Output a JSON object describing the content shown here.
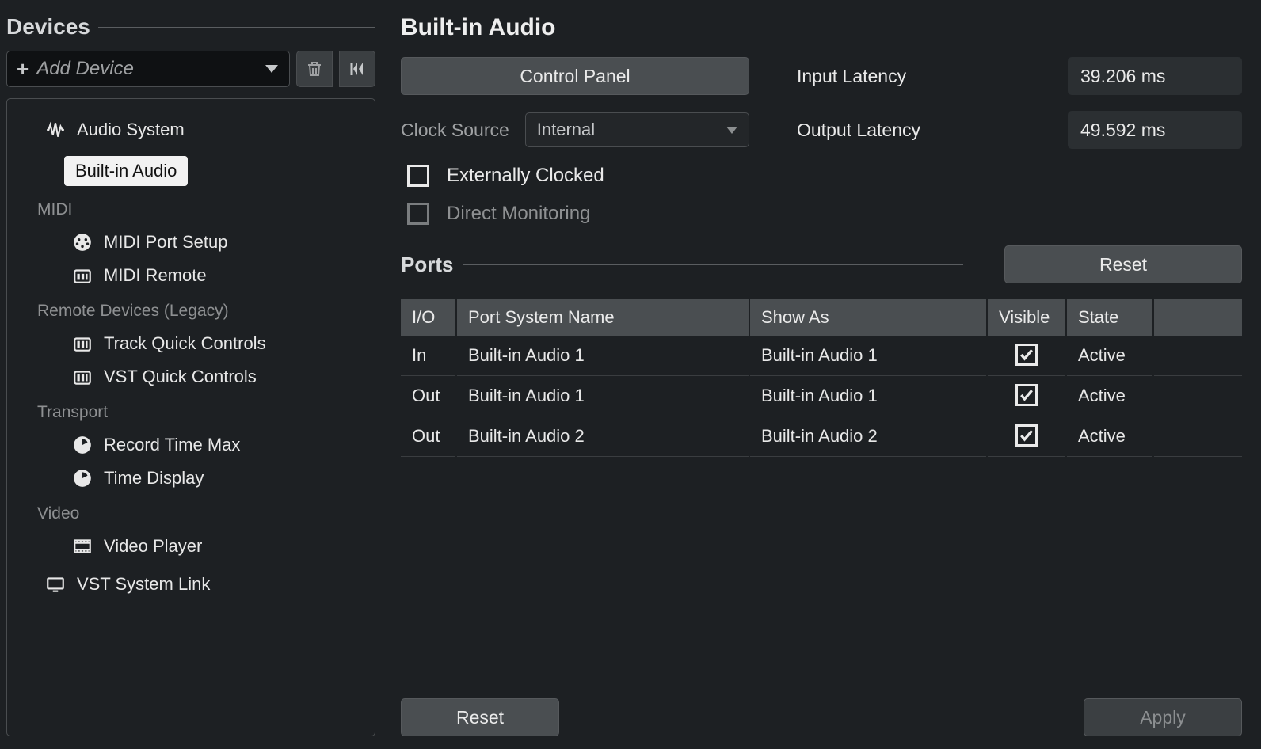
{
  "sidebar": {
    "header": "Devices",
    "add_device_label": "Add Device",
    "tree": {
      "audio_system": "Audio System",
      "built_in_audio": "Built-in Audio",
      "midi_header": "MIDI",
      "midi_port_setup": "MIDI Port Setup",
      "midi_remote": "MIDI Remote",
      "remote_header": "Remote Devices (Legacy)",
      "track_quick_controls": "Track Quick Controls",
      "vst_quick_controls": "VST Quick Controls",
      "transport_header": "Transport",
      "record_time_max": "Record Time Max",
      "time_display": "Time Display",
      "video_header": "Video",
      "video_player": "Video Player",
      "vst_system_link": "VST System Link"
    }
  },
  "main": {
    "title": "Built-in Audio",
    "control_panel": "Control Panel",
    "clock_source_label": "Clock Source",
    "clock_source_value": "Internal",
    "externally_clocked": "Externally Clocked",
    "direct_monitoring": "Direct Monitoring",
    "input_latency_label": "Input Latency",
    "input_latency_value": "39.206 ms",
    "output_latency_label": "Output Latency",
    "output_latency_value": "49.592 ms"
  },
  "ports": {
    "header": "Ports",
    "reset": "Reset",
    "columns": {
      "io": "I/O",
      "name": "Port System Name",
      "show": "Show As",
      "visible": "Visible",
      "state": "State"
    },
    "rows": [
      {
        "io": "In",
        "name": "Built-in Audio 1",
        "show": "Built-in Audio 1",
        "visible": true,
        "state": "Active"
      },
      {
        "io": "Out",
        "name": "Built-in Audio 1",
        "show": "Built-in Audio 1",
        "visible": true,
        "state": "Active"
      },
      {
        "io": "Out",
        "name": "Built-in Audio 2",
        "show": "Built-in Audio 2",
        "visible": true,
        "state": "Active"
      }
    ]
  },
  "footer": {
    "reset": "Reset",
    "apply": "Apply"
  }
}
